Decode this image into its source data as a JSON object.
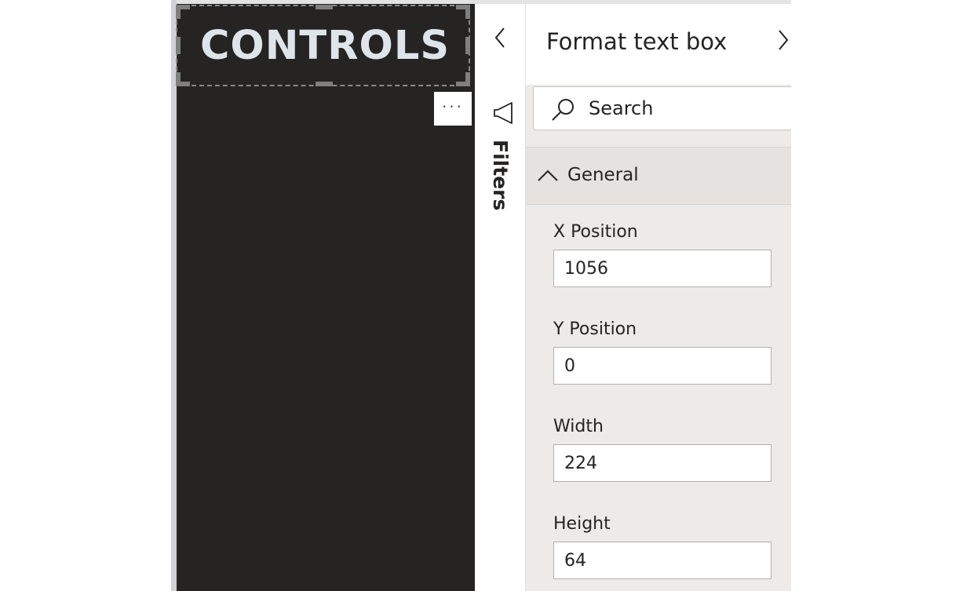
{
  "canvas": {
    "textbox_title": "CONTROLS",
    "more_options_label": "···"
  },
  "filters_pane": {
    "label": "Filters",
    "collapse_icon": "chevron-left-icon",
    "filter_icon": "megaphone-filter-icon"
  },
  "format_pane": {
    "title": "Format text box",
    "expand_icon": "chevron-right-icon",
    "search": {
      "placeholder": "Search",
      "icon": "search-icon"
    },
    "section": {
      "label": "General",
      "expanded": true
    },
    "properties": [
      {
        "label": "X Position",
        "value": "1056"
      },
      {
        "label": "Y Position",
        "value": "0"
      },
      {
        "label": "Width",
        "value": "224"
      },
      {
        "label": "Height",
        "value": "64"
      }
    ]
  },
  "colors": {
    "canvas_bg": "#252423",
    "title_text": "#dde4ea",
    "pane_bg": "#edebe9",
    "section_bg": "#e6e2df"
  }
}
